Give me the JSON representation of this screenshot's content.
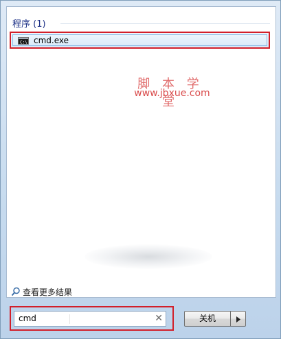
{
  "results": {
    "section_header": "程序 (1)",
    "items": [
      {
        "label": "cmd.exe",
        "icon": "cmd-icon"
      }
    ]
  },
  "watermark": {
    "title": "脚 本 学 堂",
    "url": "www.jbxue.com"
  },
  "see_more": {
    "label": "查看更多结果",
    "icon": "search-icon"
  },
  "search": {
    "value": "cmd",
    "clear_icon": "✕"
  },
  "shutdown": {
    "label": "关机",
    "icon": "chevron-right-icon"
  },
  "colors": {
    "highlight_border": "#d21f2a",
    "header_text": "#1e3287",
    "watermark": "#e06a6a"
  }
}
